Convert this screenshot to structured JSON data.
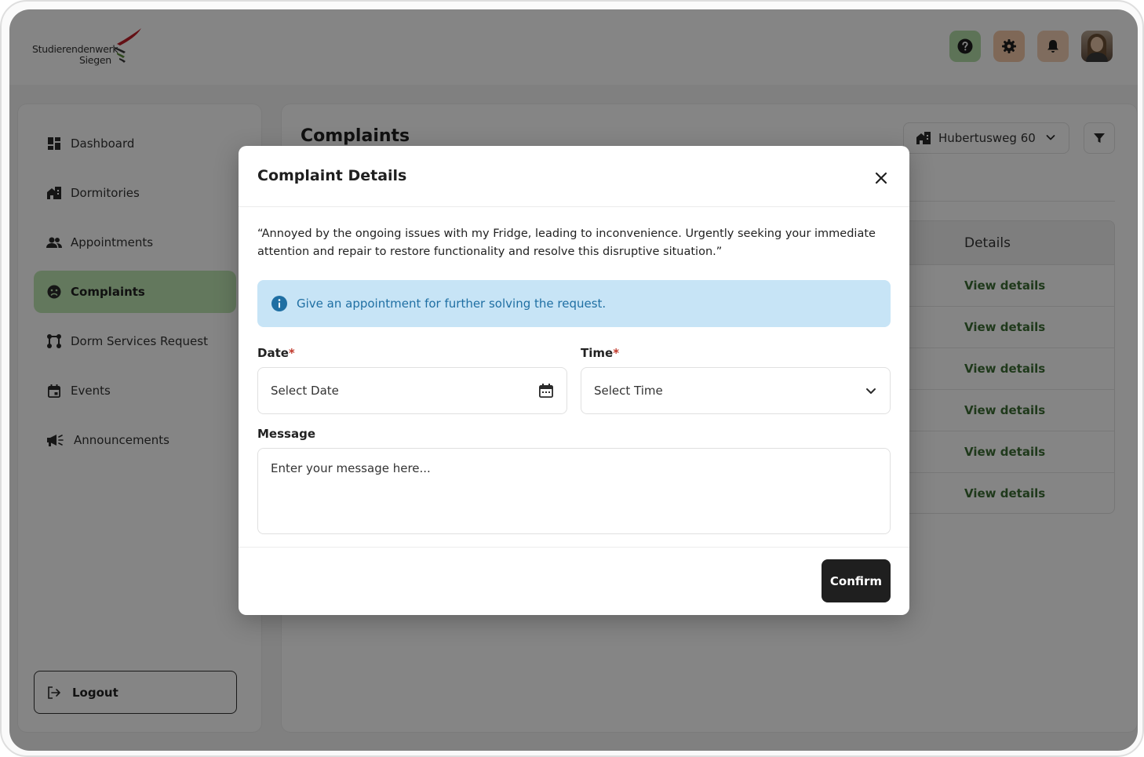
{
  "brand": {
    "line1": "Studierendenwerk",
    "line2": "Siegen"
  },
  "header": {
    "icons": [
      "help-icon",
      "gear-icon",
      "bell-icon"
    ],
    "colors": {
      "help": "#b3dca8",
      "settings": "#f3c7a8",
      "notifications": "#f3cfb4"
    }
  },
  "sidebar": {
    "items": [
      {
        "label": "Dashboard",
        "icon": "dashboard-icon"
      },
      {
        "label": "Dormitories",
        "icon": "building-icon"
      },
      {
        "label": "Appointments",
        "icon": "people-icon"
      },
      {
        "label": "Complaints",
        "icon": "sad-face-icon",
        "active": true
      },
      {
        "label": "Dorm Services Request",
        "icon": "flow-icon"
      },
      {
        "label": "Events",
        "icon": "calendar-icon"
      },
      {
        "label": "Announcements",
        "icon": "megaphone-icon"
      }
    ],
    "logout": "Logout",
    "active_color": "#bfe6b3"
  },
  "main": {
    "title": "Complaints",
    "dorm_select": "Hubertusweg 60",
    "table": {
      "header_details": "Details",
      "rows": [
        "View details",
        "View details",
        "View details",
        "View details",
        "View details",
        "View details"
      ]
    }
  },
  "modal": {
    "title": "Complaint Details",
    "quote": "“Annoyed by the ongoing issues with my Fridge, leading to inconvenience. Urgently seeking your immediate attention and repair to restore functionality and resolve this disruptive situation.”",
    "info": "Give an appointment for further solving the request.",
    "date_label": "Date",
    "date_placeholder": "Select Date",
    "time_label": "Time",
    "time_placeholder": "Select Time",
    "required_mark": "*",
    "message_label": "Message",
    "message_placeholder": "Enter your message here...",
    "confirm": "Confirm",
    "info_color": "#c7e4f6"
  }
}
